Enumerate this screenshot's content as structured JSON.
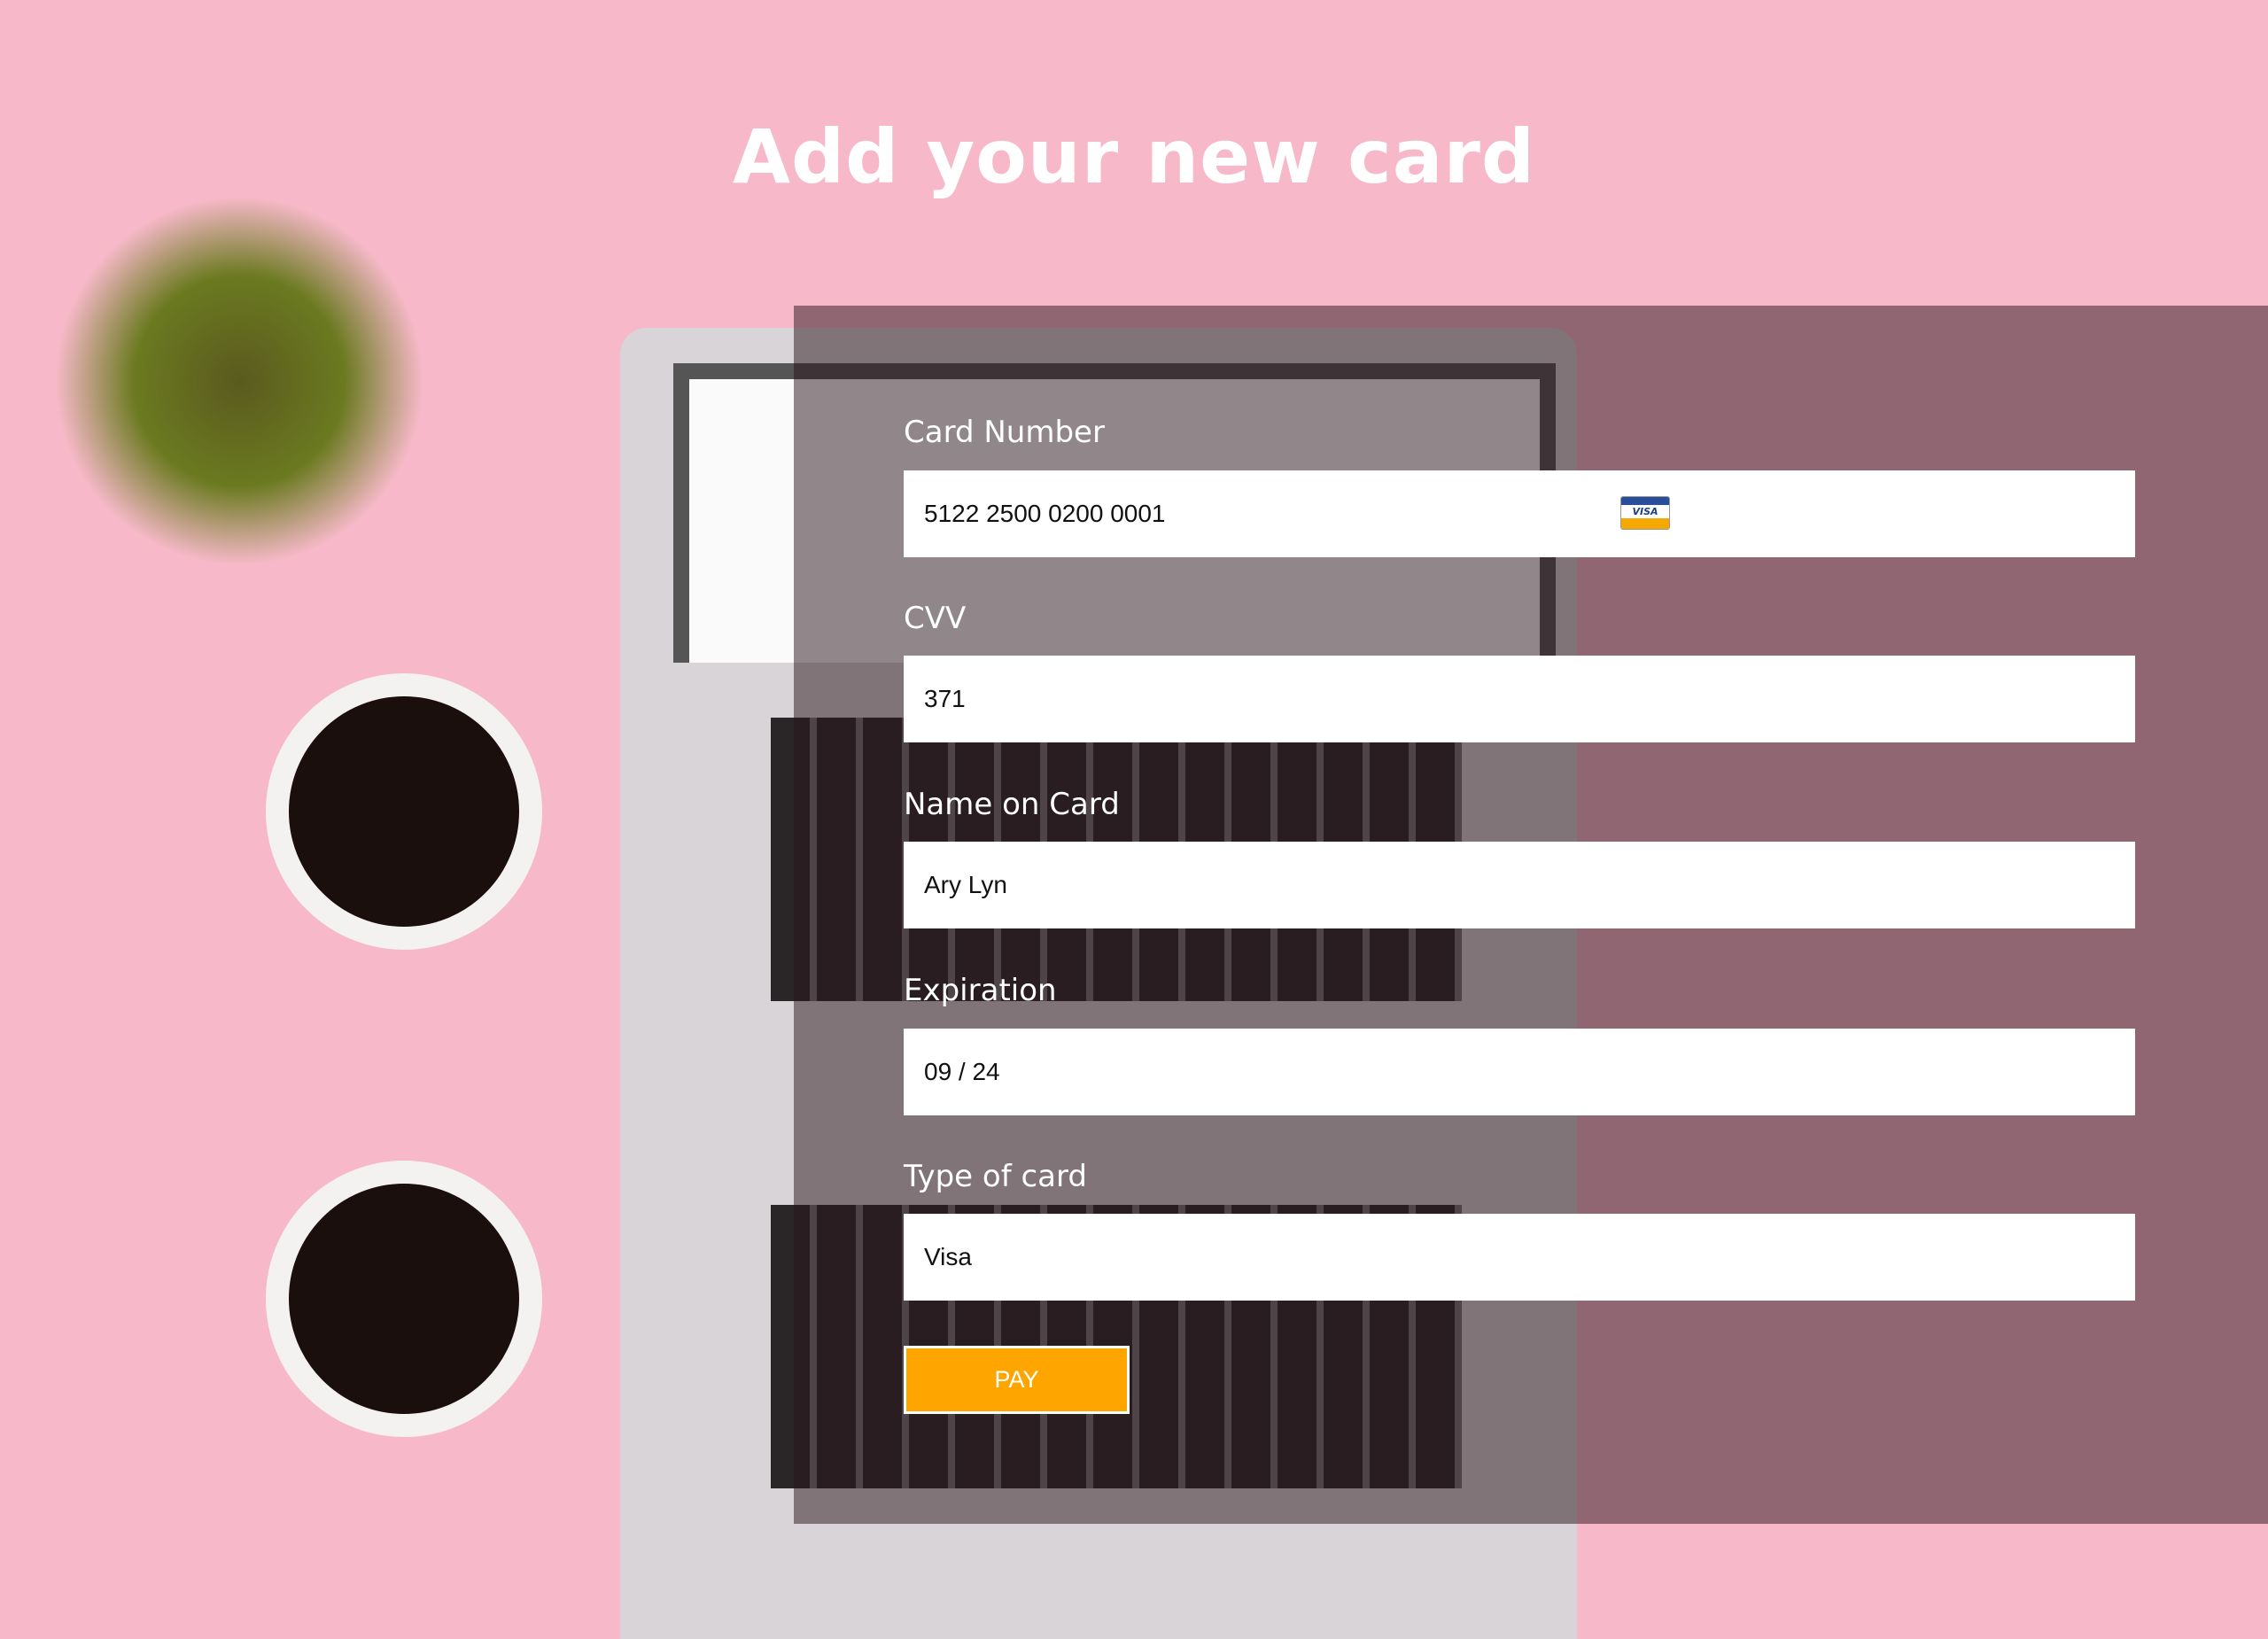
{
  "title": "Add your new card",
  "form": {
    "card_number": {
      "label": "Card Number",
      "value": "5122 2500 0200 0001",
      "icon": "visa-card-icon",
      "icon_text": "VISA"
    },
    "cvv": {
      "label": "CVV",
      "value": "371"
    },
    "name": {
      "label": "Name on Card",
      "value": "Ary Lyn"
    },
    "expiration": {
      "label": "Expiration",
      "value": "09 / 24"
    },
    "type": {
      "label": "Type of card",
      "value": "Visa"
    },
    "pay_label": "PAY"
  },
  "colors": {
    "accent": "#ffa500",
    "background": "#f7b9c9"
  }
}
